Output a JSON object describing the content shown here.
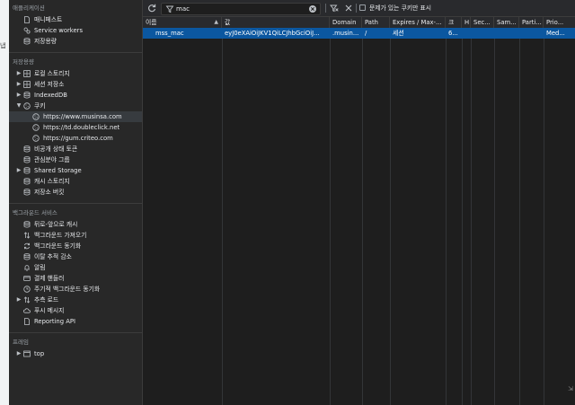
{
  "sidebar": {
    "app_items": [
      {
        "label": "매니페스트",
        "icon": "document-icon"
      },
      {
        "label": "Service workers",
        "icon": "gears-icon"
      },
      {
        "label": "저장용량",
        "icon": "database-icon"
      }
    ],
    "storage_header": "저장용량",
    "storage_items": [
      {
        "label": "로컬 스토리지",
        "icon": "grid-icon",
        "arrow": "▶",
        "level": 1
      },
      {
        "label": "세션 저장소",
        "icon": "grid-icon",
        "arrow": "▶",
        "level": 1
      },
      {
        "label": "IndexedDB",
        "icon": "database-icon",
        "arrow": "▶",
        "level": 1
      },
      {
        "label": "쿠키",
        "icon": "cookie-icon",
        "arrow": "▼",
        "level": 1
      },
      {
        "label": "https://www.musinsa.com",
        "icon": "cookie-icon",
        "arrow": "",
        "level": 2,
        "selected": true
      },
      {
        "label": "https://td.doubleclick.net",
        "icon": "cookie-icon",
        "arrow": "",
        "level": 2
      },
      {
        "label": "https://gum.criteo.com",
        "icon": "cookie-icon",
        "arrow": "",
        "level": 2
      },
      {
        "label": "비공개 상태 토큰",
        "icon": "database-icon",
        "arrow": "",
        "level": 1
      },
      {
        "label": "관심분야 그룹",
        "icon": "database-icon",
        "arrow": "",
        "level": 1
      },
      {
        "label": "Shared Storage",
        "icon": "database-icon",
        "arrow": "▶",
        "level": 1
      },
      {
        "label": "캐시 스토리지",
        "icon": "database-icon",
        "arrow": "",
        "level": 1
      },
      {
        "label": "저장소 버킷",
        "icon": "database-icon",
        "arrow": "",
        "level": 1
      }
    ],
    "background_header": "백그라운드 서비스",
    "background_items": [
      {
        "label": "뒤로-앞으로 캐시",
        "icon": "database-icon",
        "arrow": ""
      },
      {
        "label": "백그라운드 가져오기",
        "icon": "fetch-arrows-icon",
        "arrow": ""
      },
      {
        "label": "백그라운드 동기화",
        "icon": "sync-icon",
        "arrow": ""
      },
      {
        "label": "이탈 추적 감소",
        "icon": "database-icon",
        "arrow": ""
      },
      {
        "label": "알림",
        "icon": "bell-icon",
        "arrow": ""
      },
      {
        "label": "결제 핸들러",
        "icon": "card-icon",
        "arrow": ""
      },
      {
        "label": "주기적 백그라운드 동기화",
        "icon": "clock-icon",
        "arrow": ""
      },
      {
        "label": "추측 로드",
        "icon": "fetch-arrows-icon",
        "arrow": "▶"
      },
      {
        "label": "푸시 메시지",
        "icon": "cloud-icon",
        "arrow": ""
      },
      {
        "label": "Reporting API",
        "icon": "document-icon",
        "arrow": ""
      }
    ],
    "frames_header": "프레임",
    "frame_items": [
      {
        "label": "top",
        "icon": "frame-icon",
        "arrow": "▶"
      }
    ]
  },
  "toolbar": {
    "filter_value": "mac",
    "checkbox_label": "문제가 있는 쿠키만 표시",
    "refresh_icon": "refresh-icon",
    "filter_icon": "filter-icon",
    "clear_icon": "clear-circle-icon",
    "clear_filtered_icon": "filter-clear-icon",
    "delete_icon": "close-icon"
  },
  "table": {
    "columns": [
      "이름",
      "값",
      "Domain",
      "Path",
      "Expires / Max-...",
      "크",
      "H",
      "Sec...",
      "Sam...",
      "Parti...",
      "Prio..."
    ],
    "rows": [
      [
        "mss_mac",
        "eyJ0eXAiOiJKV1QiLCJhbGciOiJ...",
        ".musin...",
        "/",
        "세션",
        "6...",
        "",
        "",
        "",
        "",
        "Med..."
      ]
    ]
  },
  "left_edge_text": "냅"
}
